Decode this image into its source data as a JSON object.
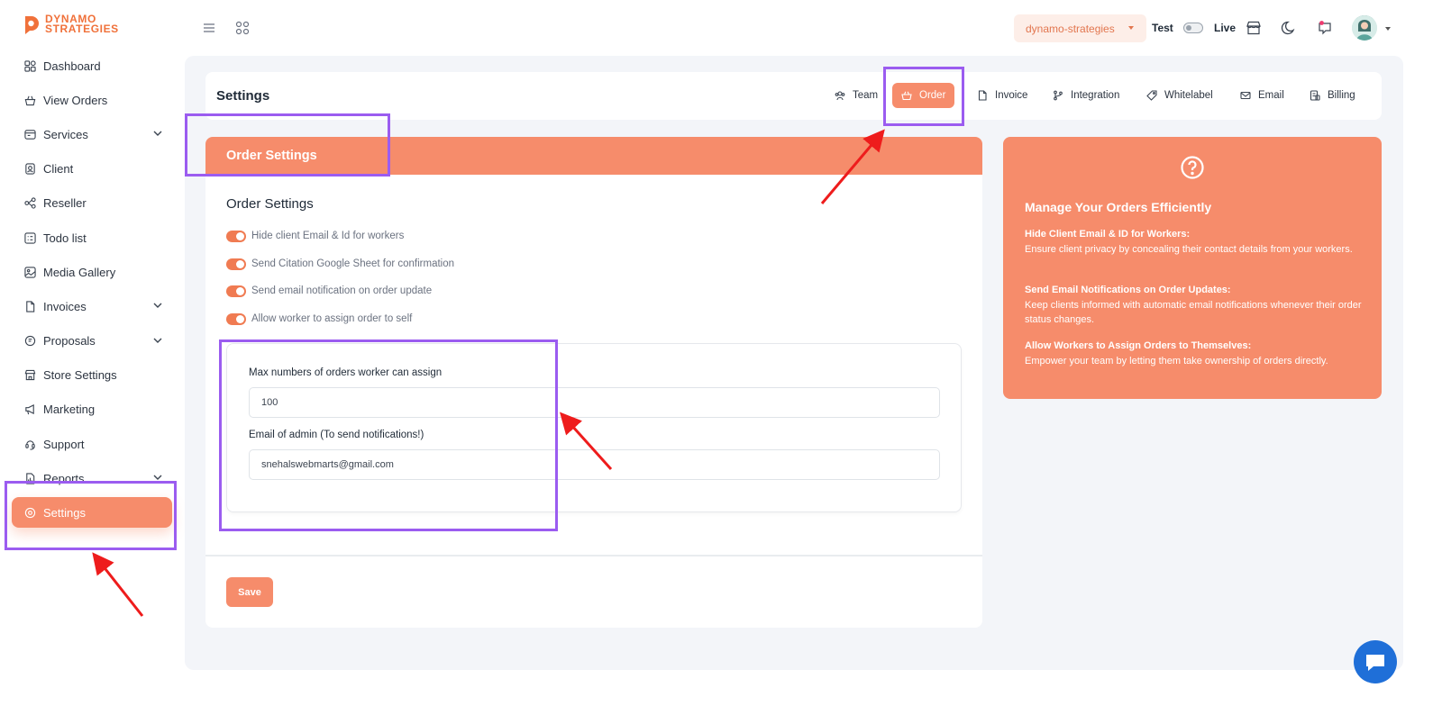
{
  "brand": {
    "line1": "DYNAMO",
    "line2": "STRATEGIES"
  },
  "sidebar": {
    "items": [
      {
        "label": "Dashboard",
        "icon": "dashboard-icon"
      },
      {
        "label": "View Orders",
        "icon": "basket-icon"
      },
      {
        "label": "Services",
        "icon": "services-icon",
        "expandable": true
      },
      {
        "label": "Client",
        "icon": "client-icon"
      },
      {
        "label": "Reseller",
        "icon": "reseller-icon"
      },
      {
        "label": "Todo list",
        "icon": "todo-icon"
      },
      {
        "label": "Media Gallery",
        "icon": "media-icon"
      },
      {
        "label": "Invoices",
        "icon": "file-icon",
        "expandable": true
      },
      {
        "label": "Proposals",
        "icon": "proposal-icon",
        "expandable": true
      },
      {
        "label": "Store Settings",
        "icon": "store-icon"
      },
      {
        "label": "Marketing",
        "icon": "megaphone-icon"
      },
      {
        "label": "Support",
        "icon": "support-icon"
      },
      {
        "label": "Reports",
        "icon": "report-icon",
        "expandable": true
      },
      {
        "label": "Settings",
        "icon": "settings-icon",
        "active": true
      }
    ]
  },
  "topbar": {
    "store": "dynamo-strategies",
    "mode_test": "Test",
    "mode_live": "Live"
  },
  "settings": {
    "title": "Settings",
    "tabs": [
      {
        "label": "Team",
        "icon": "team-icon"
      },
      {
        "label": "Order",
        "icon": "basket-icon",
        "active": true
      },
      {
        "label": "Invoice",
        "icon": "file-icon"
      },
      {
        "label": "Integration",
        "icon": "branch-icon"
      },
      {
        "label": "Whitelabel",
        "icon": "tag-icon"
      },
      {
        "label": "Email",
        "icon": "mail-icon"
      },
      {
        "label": "Billing",
        "icon": "billing-icon"
      }
    ]
  },
  "order_card": {
    "header": "Order Settings",
    "section_title": "Order Settings",
    "toggles": [
      {
        "label": "Hide client Email & Id for workers",
        "on": true
      },
      {
        "label": "Send Citation Google Sheet for confirmation",
        "on": true
      },
      {
        "label": "Send email notification on order update",
        "on": true
      },
      {
        "label": "Allow worker to assign order to self",
        "on": true
      }
    ],
    "max_orders_label": "Max numbers of orders worker can assign",
    "max_orders_value": "100",
    "admin_email_label": "Email of admin (To send notifications!)",
    "admin_email_value": "snehalswebmarts@gmail.com",
    "save_label": "Save"
  },
  "help_card": {
    "title": "Manage Your Orders Efficiently",
    "blocks": [
      {
        "heading": "Hide Client Email & ID for Workers:",
        "text": "Ensure client privacy by concealing their contact details from your workers."
      },
      {
        "heading": "Send Email Notifications on Order Updates:",
        "text": "Keep clients informed with automatic email notifications whenever their order status changes."
      },
      {
        "heading": "Allow Workers to Assign Orders to Themselves:",
        "text": "Empower your team by letting them take ownership of orders directly."
      }
    ]
  },
  "colors": {
    "accent": "#f68c6b",
    "annotation": "#9b5cf0",
    "arrow": "#ee1c1c"
  }
}
